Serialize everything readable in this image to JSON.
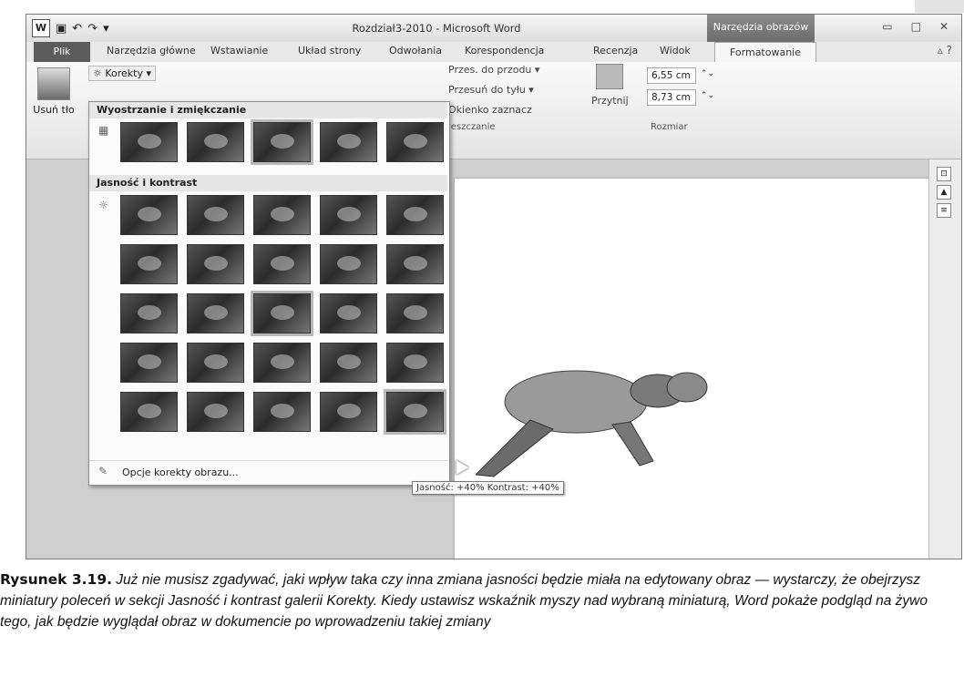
{
  "window": {
    "title": "Rozdział3-2010 - Microsoft Word",
    "context_tab": "Narzędzia obrazów",
    "buttons": [
      "▭",
      "□",
      "✕"
    ]
  },
  "tabs": {
    "file": "Plik",
    "items": [
      "Narzędzia główne",
      "Wstawianie",
      "Układ strony",
      "Odwołania",
      "Korespondencja",
      "Recenzja",
      "Widok"
    ],
    "active": "Formatowanie"
  },
  "ribbon": {
    "remove_bg": "Usuń tło",
    "corrections": "Korekty",
    "bring_forward": "Przes. do przodu",
    "send_backward": "Przesuń do tyłu",
    "selection_pane": "Okienko zaznacz",
    "arrange_label": "ieszczanie",
    "crop": "Przytnij",
    "height": "6,55 cm",
    "width": "8,73 cm",
    "size_label": "Rozmiar"
  },
  "gallery": {
    "sharpen_title": "Wyostrzanie i zmiękczanie",
    "brightness_title": "Jasność i kontrast",
    "footer": "Opcje korekty obrazu..."
  },
  "tooltip": "Jasność: +40% Kontrast: +40%",
  "caption": {
    "label": "Rysunek 3.19.",
    "text": " Już nie musisz zgadywać, jaki wpływ taka czy inna zmiana jasności będzie miała na edytowany obraz — wystarczy, że obejrzysz miniatury poleceń w sekcji Jasność i kontrast galerii Korekty. Kiedy ustawisz wskaźnik myszy nad wybraną miniaturą, Word pokaże podgląd na żywo tego, jak będzie wyglądał obraz w dokumencie po wprowadzeniu takiej zmiany"
  },
  "colors": {
    "accent": "#6d6d6d",
    "file_tab": "#5c5c5c"
  }
}
